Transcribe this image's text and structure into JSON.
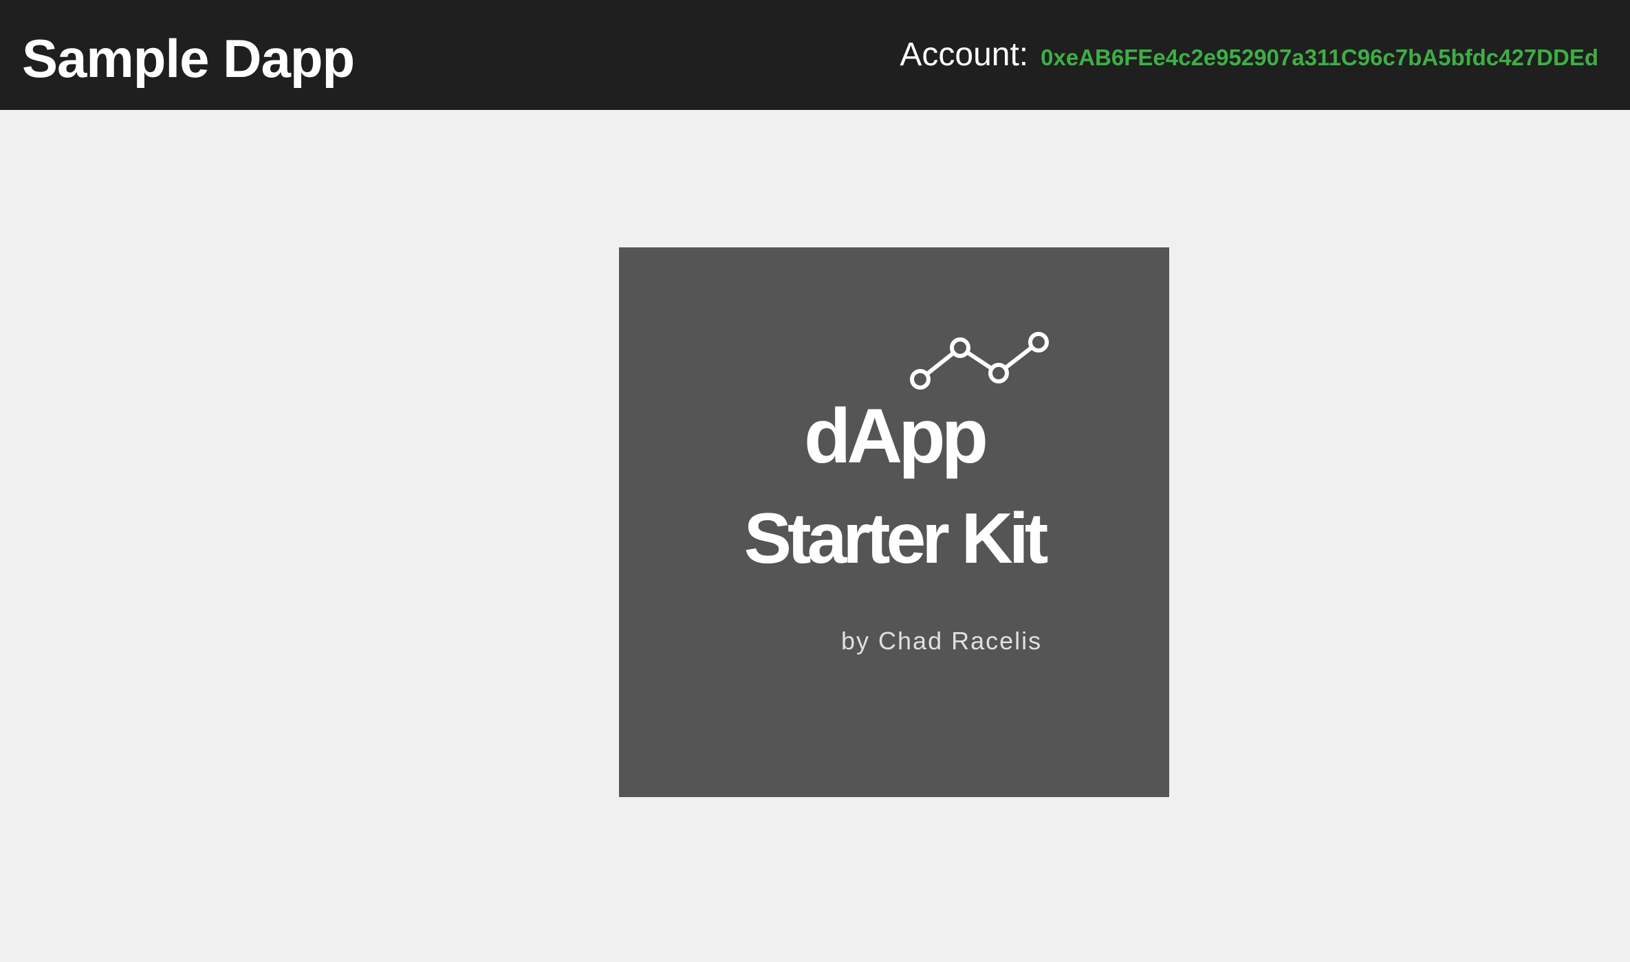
{
  "header": {
    "title": "Sample Dapp",
    "account_label": "Account:",
    "account_address": "0xeAB6FEe4c2e952907a311C96c7bA5bfdc427DDEd",
    "colors": {
      "background": "#1f1f1f",
      "address": "#3cb044"
    }
  },
  "main": {
    "logo": {
      "line1": "dApp",
      "line2": "Starter Kit",
      "byline": "by Chad Racelis",
      "icon": "line-chart-icon",
      "background": "#555555"
    }
  }
}
